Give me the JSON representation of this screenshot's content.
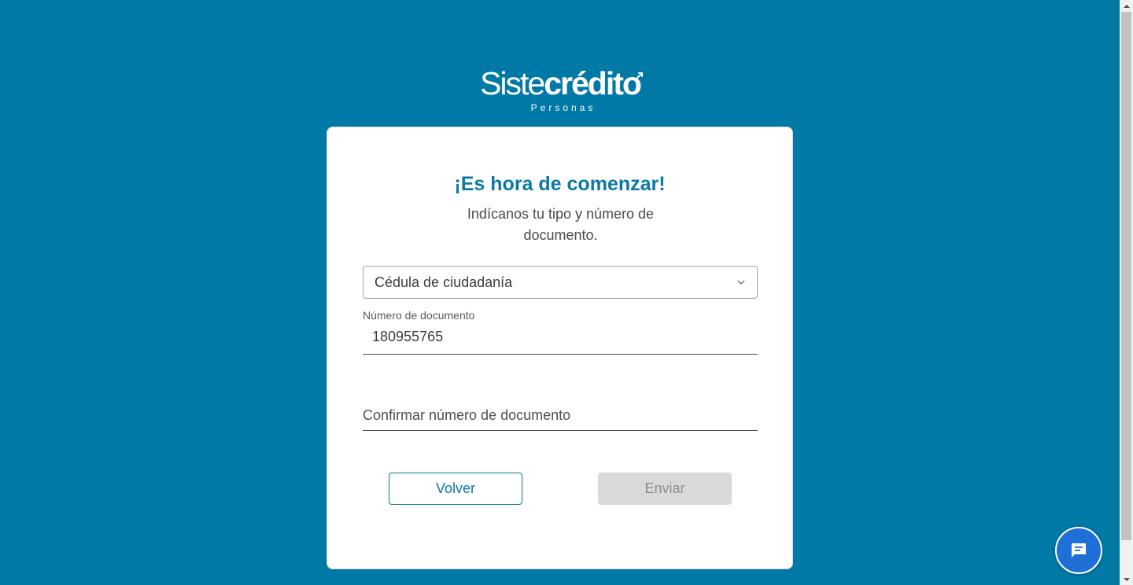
{
  "logo": {
    "light_part": "Siste",
    "bold_part": "crédito",
    "sub": "Personas"
  },
  "card": {
    "title": "¡Es hora de comenzar!",
    "subtitle": "Indícanos tu tipo y número de documento."
  },
  "document_type": {
    "selected": "Cédula de ciudadanía",
    "icon": "chevron-down-icon"
  },
  "document_number": {
    "label": "Número de documento",
    "value": "180955765"
  },
  "confirm_number": {
    "placeholder": "Confirmar número de documento",
    "value": ""
  },
  "buttons": {
    "back": "Volver",
    "send": "Enviar"
  },
  "chat": {
    "icon": "chat-icon"
  },
  "colors": {
    "background": "#0079a7",
    "accent": "#0a7aa4",
    "disabled_button": "#d9d9d9",
    "chat_button": "#1e6fd6"
  }
}
